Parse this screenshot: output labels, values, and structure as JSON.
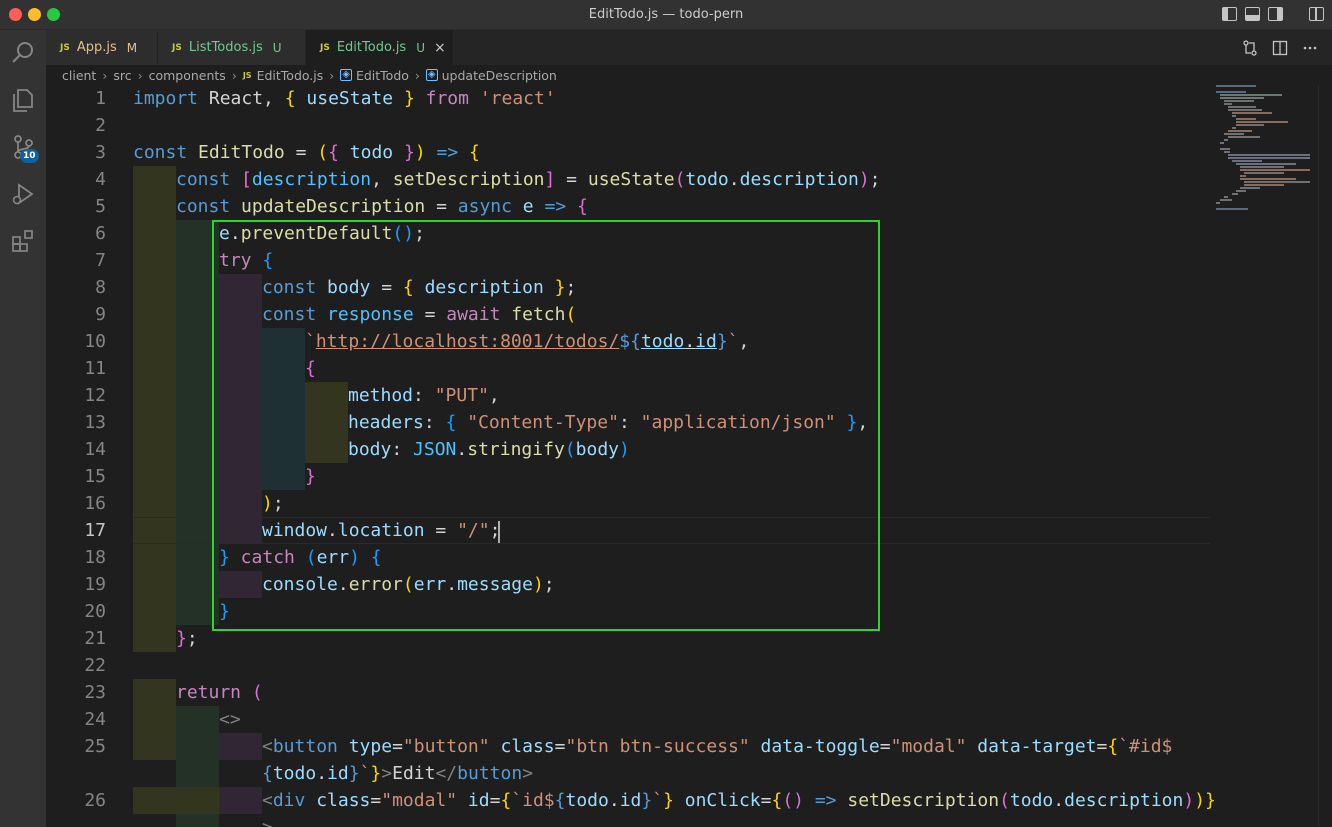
{
  "window": {
    "title": "EditTodo.js — todo-pern"
  },
  "activity_bar": {
    "items": [
      "search-icon",
      "files-icon",
      "source-control-icon",
      "run-debug-icon",
      "extensions-icon"
    ],
    "source_control_badge": "10"
  },
  "tabs": [
    {
      "icon": "JS",
      "label": "App.js",
      "status": "M",
      "active": false
    },
    {
      "icon": "JS",
      "label": "ListTodos.js",
      "status": "U",
      "active": false
    },
    {
      "icon": "JS",
      "label": "EditTodo.js",
      "status": "U",
      "active": true,
      "close": "×"
    }
  ],
  "breadcrumb": {
    "parts": [
      "client",
      "src",
      "components"
    ],
    "file": "EditTodo.js",
    "symbol_1": "EditTodo",
    "symbol_2": "updateDescription",
    "js_icon": "JS"
  },
  "editor": {
    "current_line": "17",
    "line_numbers": [
      "1",
      "2",
      "3",
      "4",
      "5",
      "6",
      "7",
      "8",
      "9",
      "10",
      "11",
      "12",
      "13",
      "14",
      "15",
      "16",
      "17",
      "18",
      "19",
      "20",
      "21",
      "22",
      "23",
      "24",
      "25",
      "",
      "26"
    ],
    "lines": {
      "l1": {
        "kw": "import",
        "a": " React, ",
        "b": "{",
        "c": " useState ",
        "d": "}",
        "e": " from ",
        "s": "'react'"
      },
      "l3": {
        "kw": "const",
        "name": " EditTodo",
        "a": " = ",
        "p1": "(",
        "b1": "{",
        "v": " todo ",
        "b2": "}",
        "p2": ")",
        "arrow": " =>",
        "b3": " {"
      },
      "l4": {
        "kw": "const",
        "a": " ",
        "br1": "[",
        "v1": "description",
        "c": ", ",
        "v2": "setDescription",
        "br2": "]",
        "d": " = ",
        "fn": "useState",
        "p1": "(",
        "v3": "todo",
        "dot": ".",
        "v4": "description",
        "p2": ")",
        "semi": ";"
      },
      "l5": {
        "kw": "const",
        "fn": " updateDescription",
        "a": " = ",
        "kw2": "async",
        "v": " e",
        "arrow": " =>",
        "b": " {"
      },
      "l6": {
        "v": "e",
        "dot": ".",
        "fn": "preventDefault",
        "p": "()",
        "semi": ";"
      },
      "l7": {
        "kc": "try",
        "b": " {"
      },
      "l8": {
        "kw": "const",
        "v": " body",
        "a": " = ",
        "b1": "{",
        "v2": " description ",
        "b2": "}",
        "semi": ";"
      },
      "l9": {
        "kw": "const",
        "v": " response",
        "a": " = ",
        "kc": "await",
        "fn": " fetch",
        "p": "("
      },
      "l10": {
        "tick": "`",
        "url": "http://localhost:8001/todos/",
        "tp1": "${",
        "v1": "todo",
        "dot": ".",
        "v2": "id",
        "tp2": "}",
        "tick2": "`",
        "comma": ","
      },
      "l11": {
        "b": "{"
      },
      "l12": {
        "k": "method",
        "c": ": ",
        "s": "\"PUT\"",
        "comma": ","
      },
      "l13": {
        "k": "headers",
        "c": ": ",
        "b1": "{",
        "s1": " \"Content-Type\"",
        "c2": ": ",
        "s2": "\"application/json\"",
        "b2": " }",
        "comma": ","
      },
      "l14": {
        "k": "body",
        "c": ": ",
        "cst": "JSON",
        "dot": ".",
        "fn": "stringify",
        "p1": "(",
        "v": "body",
        "p2": ")"
      },
      "l15": {
        "b": "}"
      },
      "l16": {
        "p": ")",
        "semi": ";"
      },
      "l17": {
        "v1": "window",
        "dot": ".",
        "v2": "location",
        "a": " = ",
        "s": "\"/\"",
        "semi": ";"
      },
      "l18": {
        "b1": "}",
        "kc": " catch",
        "a": " ",
        "p1": "(",
        "v": "err",
        "p2": ")",
        "b2": " {"
      },
      "l19": {
        "v1": "console",
        "dot": ".",
        "fn": "error",
        "p1": "(",
        "v2": "err",
        "dot2": ".",
        "v3": "message",
        "p2": ")",
        "semi": ";"
      },
      "l20": {
        "b": "}"
      },
      "l21": {
        "b": "}",
        "semi": ";"
      },
      "l23": {
        "kc": "return",
        "p": " ("
      },
      "l24": {
        "frag": "<>"
      },
      "l25": {
        "lt": "<",
        "tag": "button",
        "a1": " type",
        "eq1": "=",
        "s1": "\"button\"",
        "a2": " class",
        "eq2": "=",
        "s2": "\"btn btn-success\"",
        "a3": " data-toggle",
        "eq3": "=",
        "s3": "\"modal\"",
        "a4": " data-target",
        "eq4": "=",
        "br": "{",
        "s4": "`#id$"
      },
      "l25b": {
        "tp1": "{",
        "v1": "todo",
        "dot": ".",
        "v2": "id",
        "tp2": "}",
        "s": "`",
        "br": "}",
        "gt": ">",
        "text": "Edit",
        "close": "</",
        "tag": "button",
        "gt2": ">"
      },
      "l26": {
        "lt": "<",
        "tag": "div",
        "a1": " class",
        "eq1": "=",
        "s1": "\"modal\"",
        "a2": " id",
        "eq2": "=",
        "br1": "{",
        "s2": "`id$",
        "tp1": "{",
        "v1": "todo",
        "dot": ".",
        "v2": "id",
        "tp2": "}",
        "s3": "`",
        "br2": "}",
        "a3": " onClick",
        "eq3": "=",
        "br3": "{",
        "p1": "()",
        "arrow": " =>",
        "fn": " setDescription",
        "p2": "(",
        "v3": "todo",
        "dot2": ".",
        "v4": "description",
        "p3": ")",
        "br4": ")}"
      },
      "l27": {
        "gt": ">"
      }
    }
  },
  "colors": {
    "highlight_box": "#2bd62b",
    "background": "#1e1e1e",
    "activity_bar": "#333333",
    "badge": "#0e639c"
  }
}
